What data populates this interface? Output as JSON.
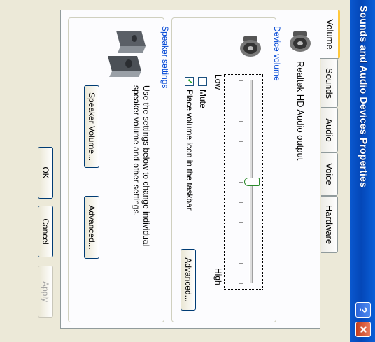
{
  "window": {
    "title": "Sounds and Audio Devices Properties",
    "help_glyph": "?",
    "close_glyph": "✕"
  },
  "tabs": [
    {
      "label": "Volume",
      "active": true
    },
    {
      "label": "Sounds",
      "active": false
    },
    {
      "label": "Audio",
      "active": false
    },
    {
      "label": "Voice",
      "active": false
    },
    {
      "label": "Hardware",
      "active": false
    }
  ],
  "device": {
    "name": "Realtek HD Audio output",
    "icon": "speaker-icon"
  },
  "device_volume": {
    "title": "Device volume",
    "low_label": "Low",
    "high_label": "High",
    "level": 0.5,
    "mute_label": "Mute",
    "mute_checked": false,
    "taskbar_label": "Place volume icon in the taskbar",
    "taskbar_checked": true,
    "advanced_label": "Advanced..."
  },
  "speaker_settings": {
    "title": "Speaker settings",
    "description": "Use the settings below to change individual speaker volume and other settings.",
    "volume_button": "Speaker Volume...",
    "advanced_button": "Advanced..."
  },
  "footer": {
    "ok": "OK",
    "cancel": "Cancel",
    "apply": "Apply"
  },
  "colors": {
    "titlebar": "#0447b8",
    "group_label": "#0046d5",
    "active_tab_accent": "#ffc83c"
  }
}
